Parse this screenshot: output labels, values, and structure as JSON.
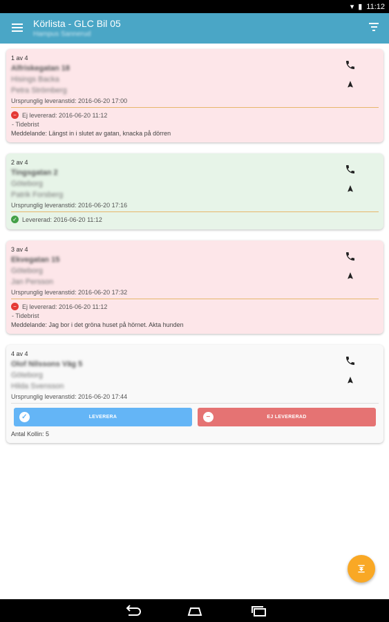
{
  "statusbar": {
    "time": "11:12",
    "wifi_icon": "wifi-icon",
    "battery_icon": "battery-icon"
  },
  "appbar": {
    "title": "Körlista - GLC Bil 05",
    "subtitle": "Hampus Sannerud"
  },
  "cards": [
    {
      "counter": "1 av 4",
      "address": "Alfriskegatan 18",
      "city": "Hisings Backa",
      "recipient": "Petra Strömberg",
      "orig_time": "Ursprunglig leveranstid: 2016-06-20 17:00",
      "status": "Ej levererad: 2016-06-20 11:12",
      "reason": "- Tidebrist",
      "message": "Meddelande: Längst in i slutet av gatan, knacka på dörren"
    },
    {
      "counter": "2 av 4",
      "address": "Tingsgatan 2",
      "city": "Göteborg",
      "recipient": "Patrik Forsberg",
      "orig_time": "Ursprunglig leveranstid: 2016-06-20 17:16",
      "status": "Levererad: 2016-06-20 11:12"
    },
    {
      "counter": "3 av 4",
      "address": "Ekvegatan 15",
      "city": "Göteborg",
      "recipient": "Jan Persson",
      "orig_time": "Ursprunglig leveranstid: 2016-06-20 17:32",
      "status": "Ej levererad: 2016-06-20 11:12",
      "reason": "- Tidebrist",
      "message": "Meddelande: Jag bor i det gröna huset på hörnet.  Akta hunden"
    },
    {
      "counter": "4 av 4",
      "address": "Olof Nilssons Väg 5",
      "city": "Göteborg",
      "recipient": "Hilda Svensson",
      "orig_time": "Ursprunglig leveranstid: 2016-06-20 17:44",
      "deliver_label": "LEVERERA",
      "not_deliver_label": "EJ LEVERERAD",
      "packages": "Antal Kollin: 5"
    }
  ],
  "colors": {
    "appbar": "#4aa6c6",
    "red_card": "#fde6e9",
    "green_card": "#e7f4e8",
    "fab": "#f9a825"
  }
}
